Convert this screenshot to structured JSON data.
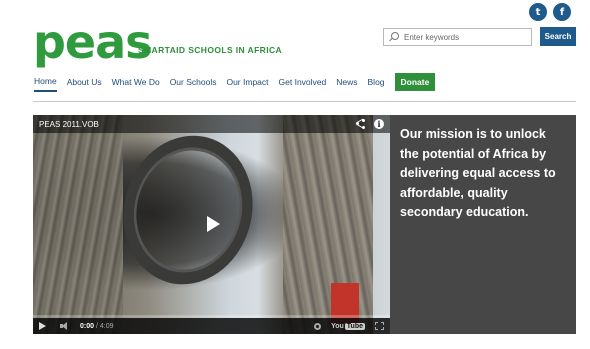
{
  "social": {
    "twitter_glyph": "t",
    "facebook_glyph": "f"
  },
  "logo": {
    "text": "peas",
    "tagline": "SMARTAID SCHOOLS IN AFRICA"
  },
  "search": {
    "placeholder": "Enter keywords",
    "button_label": "Search"
  },
  "nav": {
    "items": [
      {
        "label": "Home",
        "active": true
      },
      {
        "label": "About Us"
      },
      {
        "label": "What We Do"
      },
      {
        "label": "Our Schools"
      },
      {
        "label": "Our Impact"
      },
      {
        "label": "Get Involved"
      },
      {
        "label": "News"
      },
      {
        "label": "Blog"
      }
    ],
    "donate_label": "Donate"
  },
  "video": {
    "title": "PEAS 2011.VOB",
    "current_time": "0:00",
    "duration": "/ 4:09",
    "progress_fraction": 0,
    "youtube_you": "You",
    "youtube_tube": "Tube",
    "info_glyph": "i"
  },
  "mission": {
    "text": "Our mission is to unlock the potential of Africa by delivering equal access to affordable, quality secondary education."
  },
  "colors": {
    "brand_green": "#2f9a3e",
    "brand_blue": "#1e5a8c",
    "mission_bg": "#474747",
    "donate_bg": "#2f8f3a"
  }
}
